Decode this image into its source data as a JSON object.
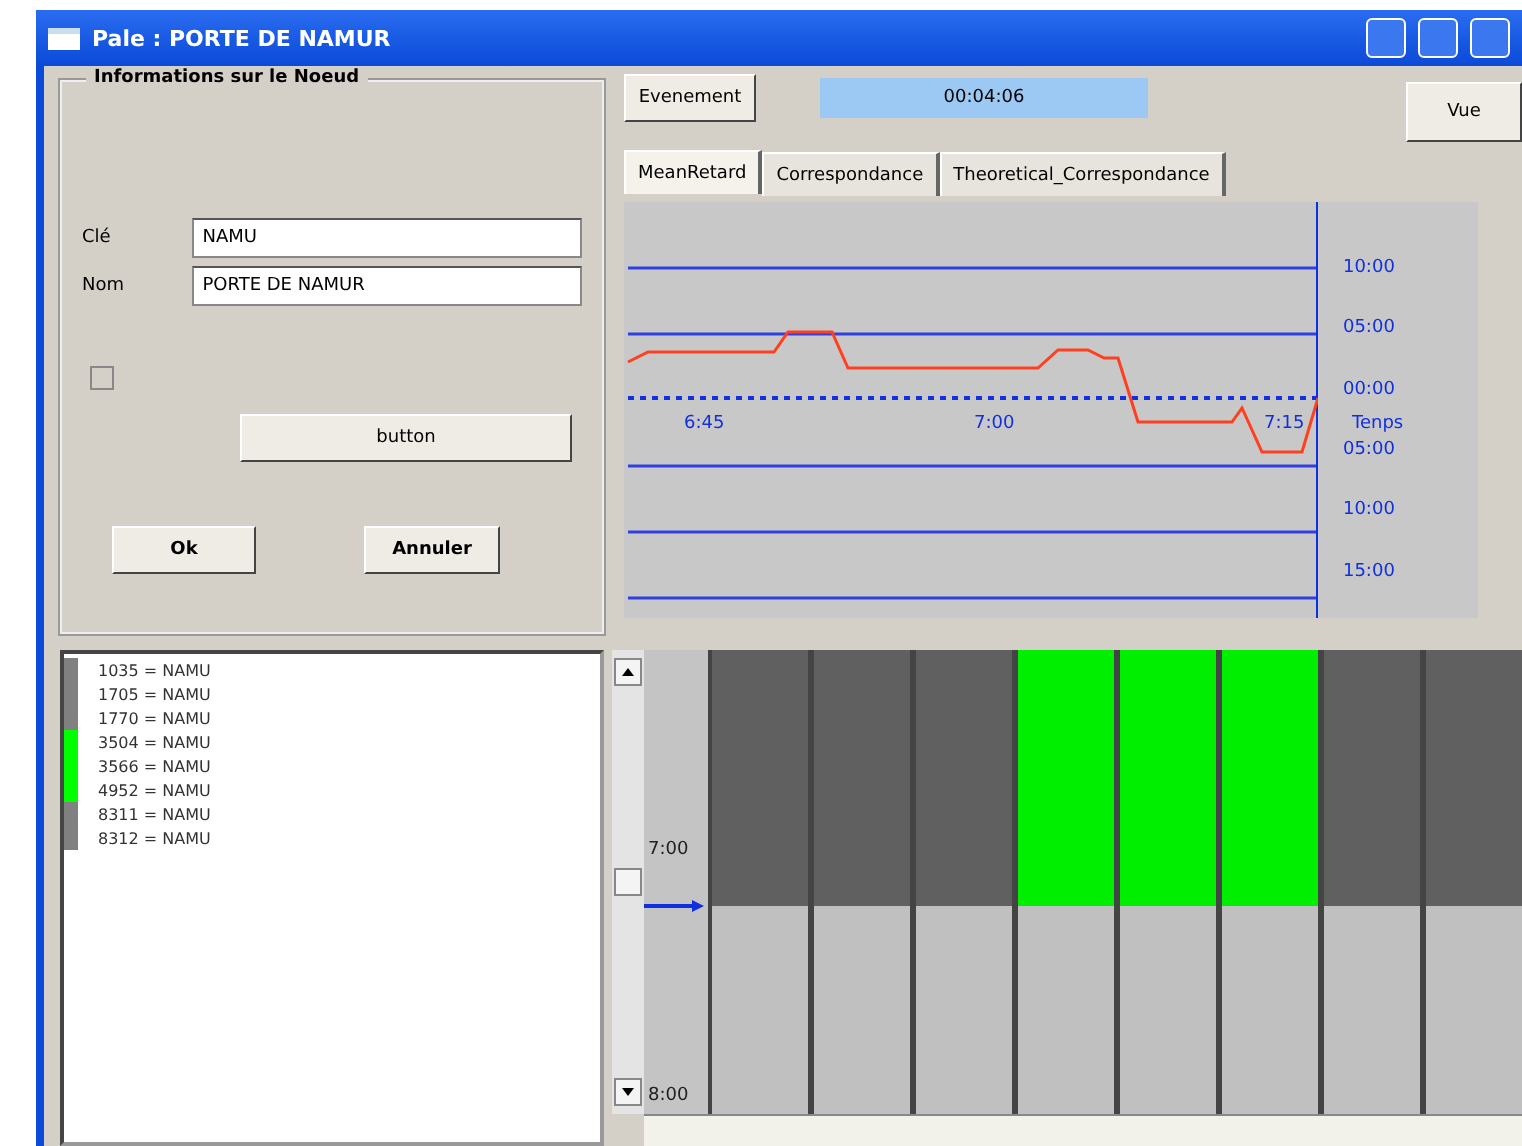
{
  "window": {
    "title": "Pale : PORTE DE NAMUR"
  },
  "node_info": {
    "title": "Informations sur le Noeud",
    "fields": [
      {
        "label": "Clé",
        "value": "NAMU"
      },
      {
        "label": "Nom",
        "value": "PORTE DE NAMUR"
      }
    ],
    "checkbox": {
      "checked": false,
      "disabled": true
    },
    "action_button": "button",
    "ok_button": "Ok",
    "cancel_button": "Annuler"
  },
  "toolbar": {
    "event_button": "Evenement",
    "time": "00:04:06",
    "view_button": "Vue"
  },
  "tabs": [
    {
      "label": "MeanRetard",
      "selected": true
    },
    {
      "label": "Correspondance",
      "selected": false
    },
    {
      "label": "Theoretical_Correspondance",
      "selected": false
    }
  ],
  "chart": {
    "y_labels": [
      "10:00",
      "05:00",
      "00:00",
      "05:00",
      "10:00",
      "15:00"
    ],
    "x_labels": [
      "6:45",
      "7:00",
      "7:15"
    ],
    "axis_label": "Tenps"
  },
  "stops": [
    {
      "label": "1035 = NAMU",
      "color": "#808080"
    },
    {
      "label": "1705 = NAMU",
      "color": "#808080"
    },
    {
      "label": "1770 = NAMU",
      "color": "#808080"
    },
    {
      "label": "3504 = NAMU",
      "color": "#00ff00"
    },
    {
      "label": "3566 = NAMU",
      "color": "#00ff00"
    },
    {
      "label": "4952 = NAMU",
      "color": "#00ff00"
    },
    {
      "label": "8311 = NAMU",
      "color": "#808080"
    },
    {
      "label": "8312 = NAMU",
      "color": "#808080"
    }
  ],
  "timeline": {
    "time_labels": [
      "7:00",
      "8:00"
    ],
    "columns": [
      {
        "color": "#606060"
      },
      {
        "color": "#606060"
      },
      {
        "color": "#606060"
      },
      {
        "color": "#00ee00"
      },
      {
        "color": "#00ee00"
      },
      {
        "color": "#00ee00"
      },
      {
        "color": "#606060"
      },
      {
        "color": "#606060"
      }
    ]
  }
}
